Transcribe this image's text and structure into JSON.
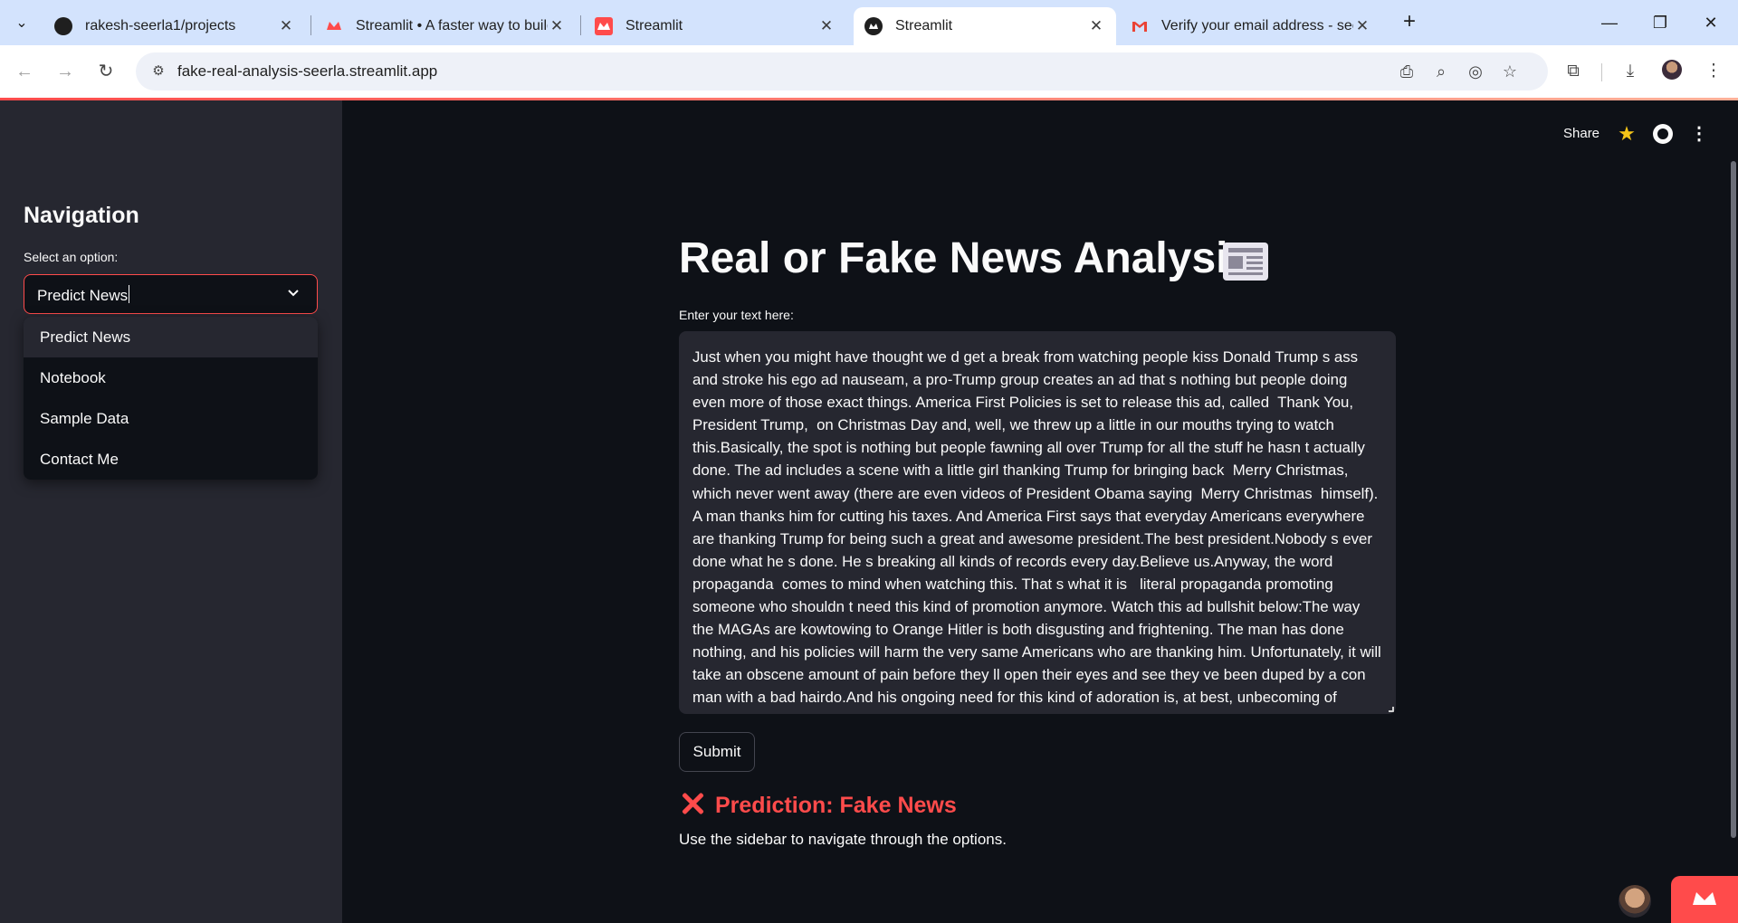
{
  "browser": {
    "tabs": [
      {
        "title": "rakesh-seerla1/projects",
        "favicon": "github-icon"
      },
      {
        "title": "Streamlit • A faster way to build",
        "favicon": "streamlit-icon"
      },
      {
        "title": "Streamlit",
        "favicon": "streamlit-icon"
      },
      {
        "title": "Streamlit",
        "favicon": "streamlit-icon"
      },
      {
        "title": "Verify your email address - seer",
        "favicon": "gmail-icon"
      }
    ],
    "active_tab_index": 3,
    "url": "fake-real-analysis-seerla.streamlit.app"
  },
  "sidebar": {
    "title": "Navigation",
    "select_label": "Select an option:",
    "selected_value": "Predict News",
    "options": [
      "Predict News",
      "Notebook",
      "Sample Data",
      "Contact Me"
    ]
  },
  "header": {
    "share_label": "Share"
  },
  "main": {
    "title": "Real or Fake News Analysis",
    "title_icon": "newspaper-icon",
    "text_label": "Enter your text here:",
    "text_value": "Just when you might have thought we d get a break from watching people kiss Donald Trump s ass and stroke his ego ad nauseam, a pro-Trump group creates an ad that s nothing but people doing even more of those exact things. America First Policies is set to release this ad, called  Thank You, President Trump,  on Christmas Day and, well, we threw up a little in our mouths trying to watch this.Basically, the spot is nothing but people fawning all over Trump for all the stuff he hasn t actually done. The ad includes a scene with a little girl thanking Trump for bringing back  Merry Christmas,  which never went away (there are even videos of President Obama saying  Merry Christmas  himself). A man thanks him for cutting his taxes. And America First says that everyday Americans everywhere are thanking Trump for being such a great and awesome president.The best president.Nobody s ever done what he s done. He s breaking all kinds of records every day.Believe us.Anyway, the word  propaganda  comes to mind when watching this. That s what it is   literal propaganda promoting someone who shouldn t need this kind of promotion anymore. Watch this ad bullshit below:The way the MAGAs are kowtowing to Orange Hitler is both disgusting and frightening. The man has done nothing, and his policies will harm the very same Americans who are thanking him. Unfortunately, it will take an obscene amount of pain before they ll open their eyes and see they ve been duped by a con man with a bad hairdo.And his ongoing need for this kind of adoration is, at best, unbecoming of",
    "submit_label": "Submit",
    "prediction": "Prediction: Fake News",
    "hint": "Use the sidebar to navigate through the options."
  },
  "colors": {
    "accent": "#ff4b4b",
    "background": "#0e1117",
    "sidebar": "#262730",
    "text": "#fafafa"
  }
}
